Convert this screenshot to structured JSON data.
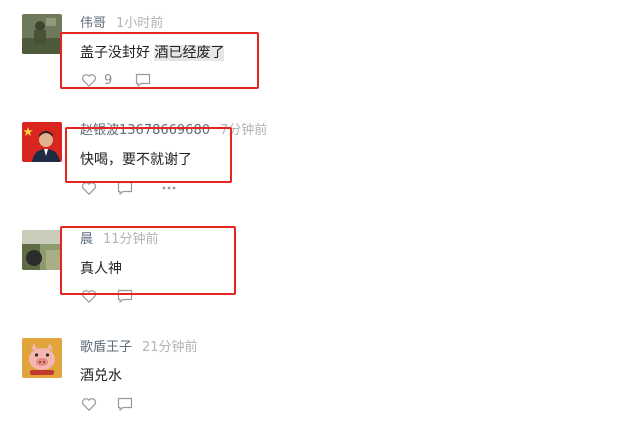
{
  "comments": [
    {
      "username": "伟哥",
      "time": "1小时前",
      "text_plain": "盖子没封好 ",
      "text_highlight": "酒已经废了",
      "likes": "9",
      "avatar": "soldier-photo"
    },
    {
      "username": "赵银波13678669680",
      "time": "7分钟前",
      "text_plain": "快喝，要不就谢了",
      "avatar": "man-with-flag-photo"
    },
    {
      "username": "晨",
      "time": "11分钟前",
      "text_plain": "真人神",
      "avatar": "outdoor-photo"
    },
    {
      "username": "歌盾王子",
      "time": "21分钟前",
      "text_plain": "酒兑水",
      "avatar": "cartoon-pig-logo"
    }
  ],
  "icons": {
    "like": "heart-outline-icon",
    "reply": "comment-bubble-icon",
    "more": "more-dots-icon"
  },
  "colors": {
    "username": "#5f6b7a",
    "time": "#b3b3b3",
    "text": "#222222",
    "highlight_bg": "#e6e6e6",
    "annotation_box": "#e5251e",
    "icon": "#9a9a9a"
  }
}
